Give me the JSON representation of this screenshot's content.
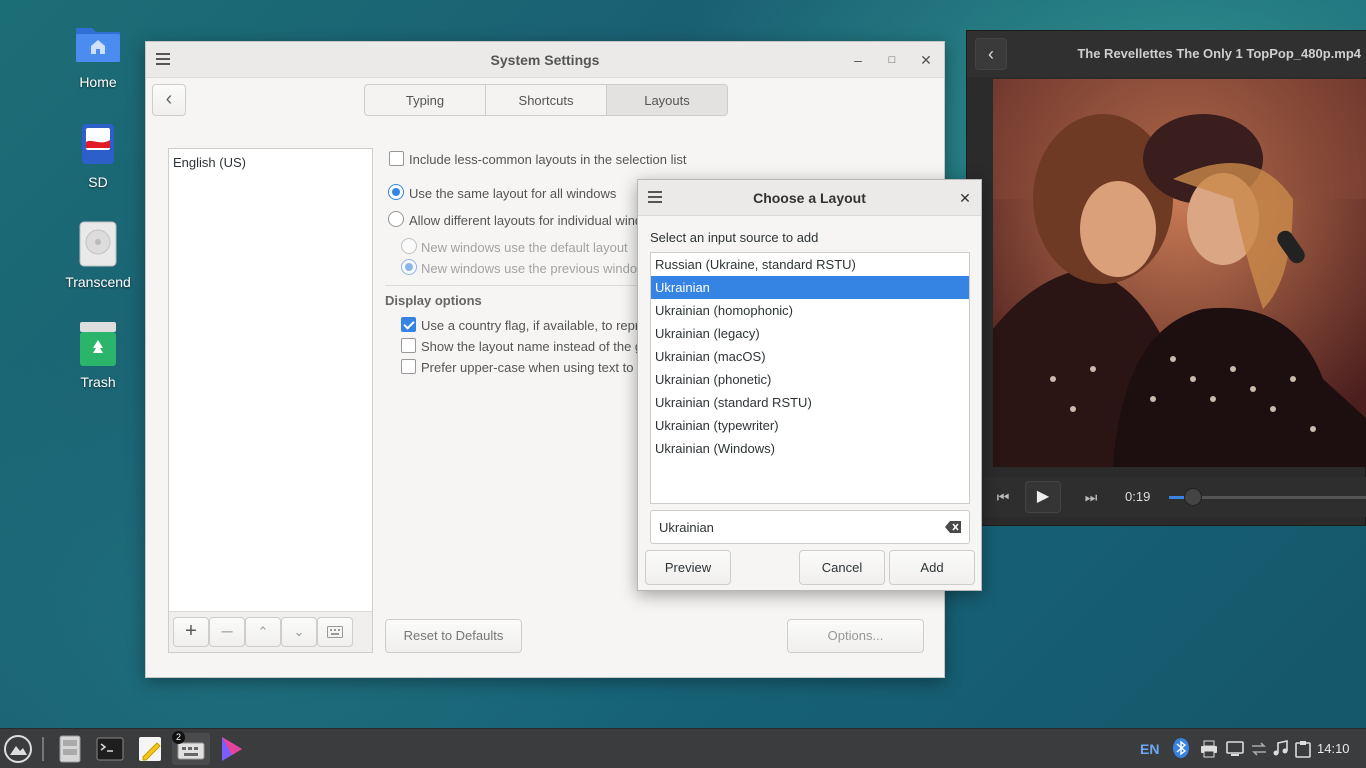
{
  "desktop": {
    "icons": [
      {
        "label": "Home",
        "icon": "folder-home-icon"
      },
      {
        "label": "SD",
        "icon": "sd-card-icon"
      },
      {
        "label": "Transcend",
        "icon": "drive-icon"
      },
      {
        "label": "Trash",
        "icon": "trash-icon"
      }
    ]
  },
  "settings": {
    "title": "System Settings",
    "tabs": [
      {
        "label": "Typing",
        "active": false
      },
      {
        "label": "Shortcuts",
        "active": false
      },
      {
        "label": "Layouts",
        "active": true
      }
    ],
    "layouts": [
      "English (US)"
    ],
    "include_less_common": "Include less-common layouts in the selection list",
    "same_layout": "Use the same layout for all windows",
    "different_layouts": "Allow different layouts for individual windo",
    "new_default": "New windows use the default layout",
    "new_previous": "New windows use the previous window",
    "display_options": "Display options",
    "country_flag": "Use a country flag, if available,  to repre",
    "show_layout_name": "Show the layout name instead of the gr",
    "prefer_uppercase": "Prefer upper-case when using text to re",
    "reset_defaults": "Reset to Defaults",
    "options": "Options..."
  },
  "dialog": {
    "title": "Choose a Layout",
    "prompt": "Select an input source to add",
    "items": [
      "Russian (Ukraine, standard RSTU)",
      "Ukrainian",
      "Ukrainian (homophonic)",
      "Ukrainian (legacy)",
      "Ukrainian (macOS)",
      "Ukrainian (phonetic)",
      "Ukrainian (standard RSTU)",
      "Ukrainian (typewriter)",
      "Ukrainian (Windows)"
    ],
    "selected_index": 1,
    "search_value": "Ukrainian",
    "preview": "Preview",
    "cancel": "Cancel",
    "add": "Add"
  },
  "player": {
    "title": "The Revellettes  The Only 1  TopPop_480p.mp4",
    "time": "0:19",
    "progress": 0.12
  },
  "taskbar": {
    "badge": "2",
    "keyboard_layout": "EN",
    "clock": "14:10"
  }
}
